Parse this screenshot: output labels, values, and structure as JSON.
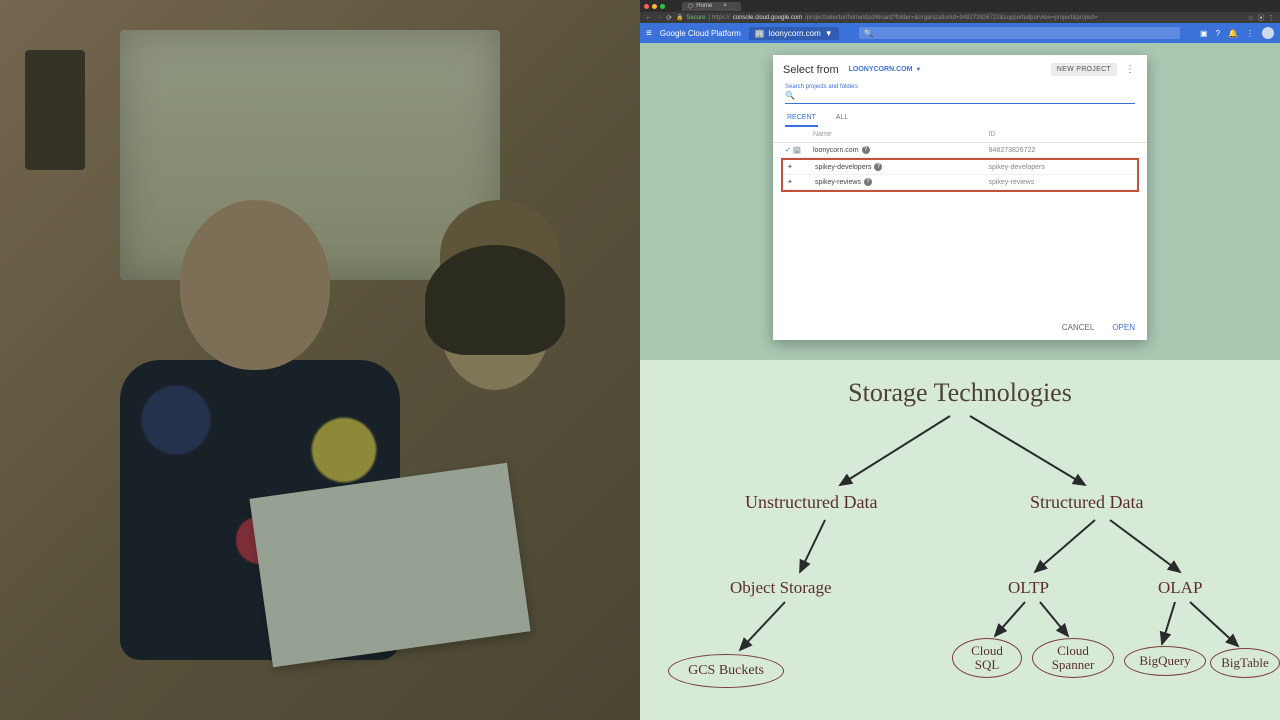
{
  "browser": {
    "tab_title": "Home",
    "secure_label": "Secure",
    "url_host": "console.cloud.google.com",
    "url_path": "/projectselector/home/dashboard?folder=&organizationId=948273826722&supportedpurview=project&project="
  },
  "gcp": {
    "brand": "Google Cloud Platform",
    "project_selector": "loonycorn.com"
  },
  "modal": {
    "title": "Select from",
    "org": "LOONYCORN.COM",
    "new_project": "NEW PROJECT",
    "search_label": "Search projects and folders",
    "search_value": "",
    "tabs": {
      "recent": "RECENT",
      "all": "ALL"
    },
    "columns": {
      "name": "Name",
      "id": "ID"
    },
    "rows": [
      {
        "kind": "org",
        "selected": true,
        "name": "loonycorn.com",
        "id": "948273826722"
      },
      {
        "kind": "proj",
        "selected": false,
        "name": "spikey-developers",
        "id": "spikey-developers"
      },
      {
        "kind": "proj",
        "selected": false,
        "name": "spikey-reviews",
        "id": "spikey-reviews"
      }
    ],
    "cancel": "CANCEL",
    "open": "OPEN"
  },
  "diagram": {
    "title": "Storage Technologies",
    "unstructured": "Unstructured Data",
    "structured": "Structured Data",
    "object_storage": "Object Storage",
    "oltp": "OLTP",
    "olap": "OLAP",
    "gcs": "GCS Buckets",
    "cloud_sql": "Cloud SQL",
    "cloud_spanner": "Cloud Spanner",
    "bigquery": "BigQuery",
    "bigtable": "BigTable"
  }
}
